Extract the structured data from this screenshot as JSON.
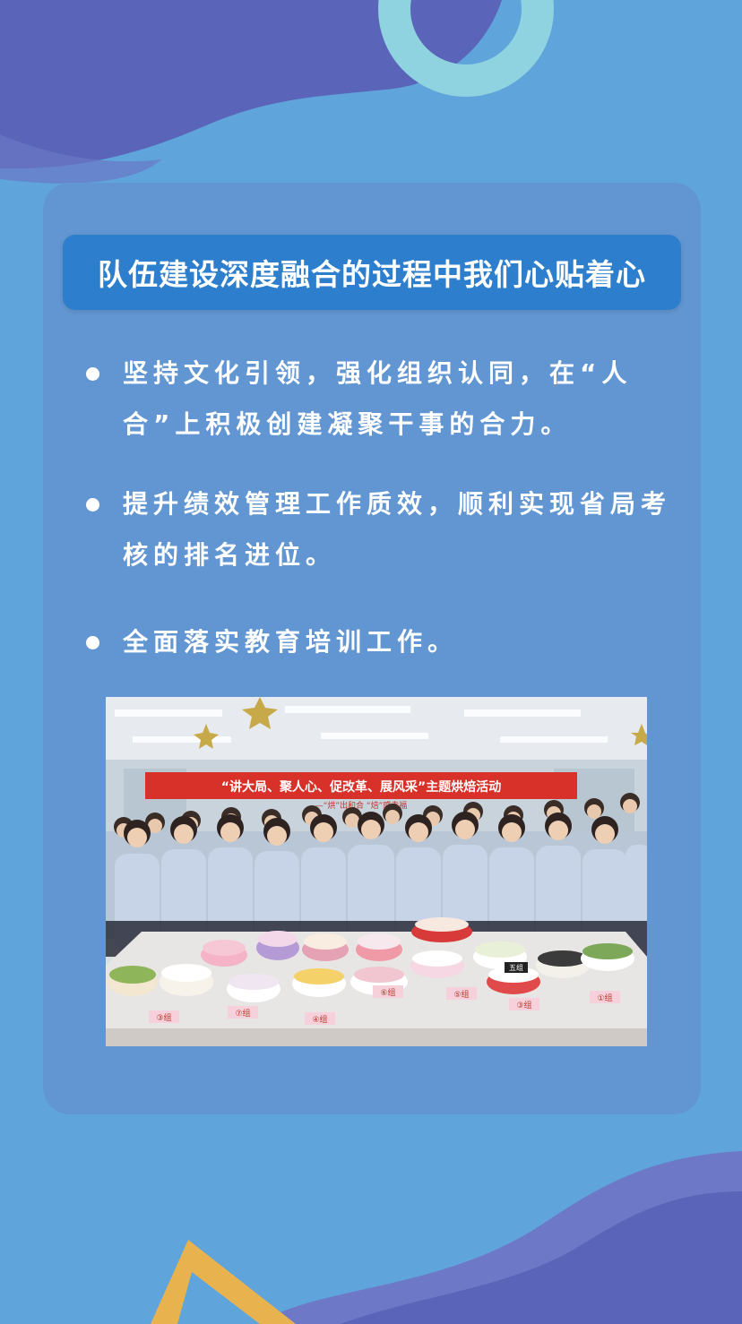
{
  "title": "队伍建设深度融合的过程中我们心贴着心",
  "bullets": [
    "坚持文化引领，强化组织认同，在“人合”上积极创建凝聚干事的合力。",
    "提升绩效管理工作质效，顺利实现省局考核的排名进位。",
    "全面落实教育培训工作。"
  ],
  "photo": {
    "banner_main": "“讲大局、聚人心、促改革、展风采”主题烘焙活动",
    "banner_sub": "—“烘”出和合    “焙”感幸福",
    "table_cards": [
      "③组",
      "⑦组",
      "④组",
      "⑥组",
      "⑤组",
      "③组",
      "①组"
    ],
    "cake_tag": "五组"
  },
  "colors": {
    "background": "#5fa5dc",
    "card": "#6296d2",
    "title_bar": "#2d7fcd",
    "purple_wave": "#5a64b8",
    "teal_ring": "#8fd3e0",
    "gold_triangle": "#e8b24e"
  }
}
